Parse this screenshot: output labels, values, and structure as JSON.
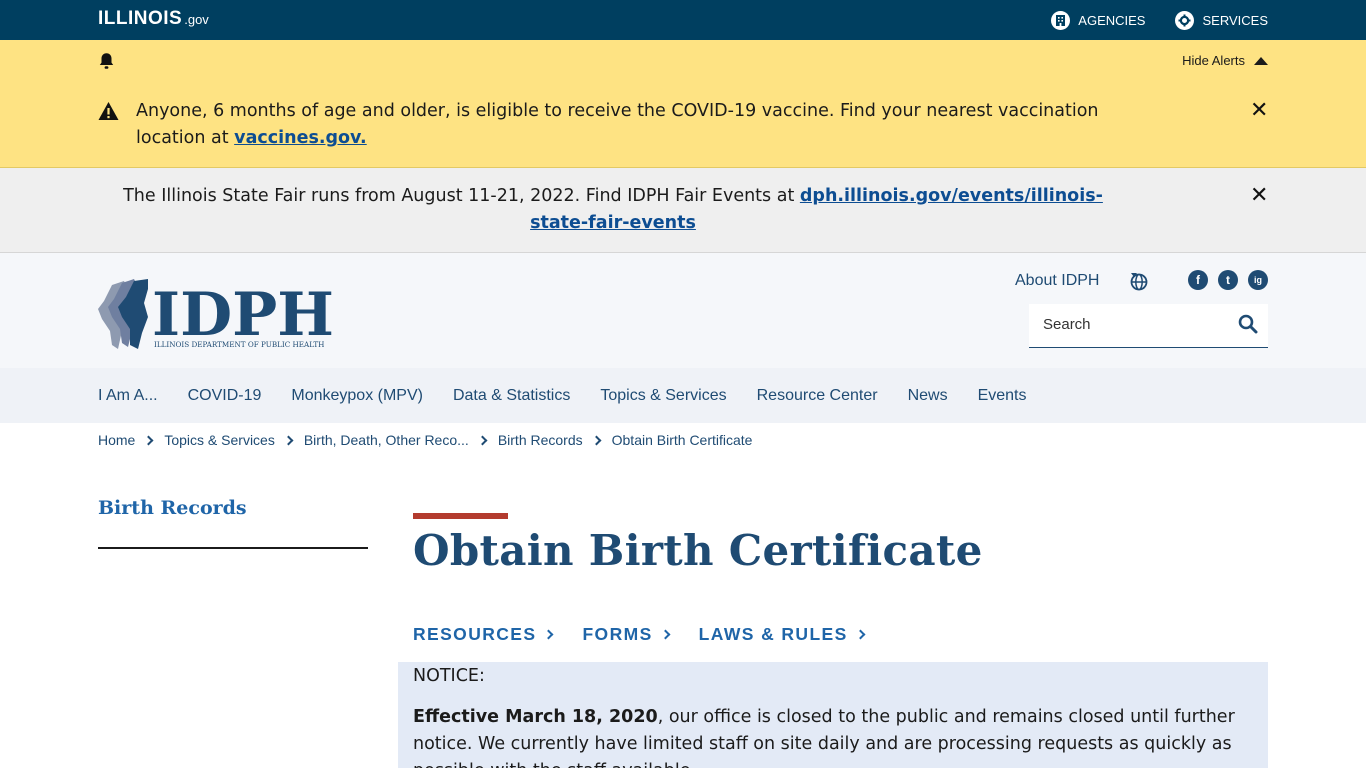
{
  "topbar": {
    "logo_main": "ILLINOIS",
    "logo_suffix": ".gov",
    "agencies_label": "AGENCIES",
    "services_label": "SERVICES"
  },
  "alerts": {
    "hide_label": "Hide Alerts",
    "covid_text": "Anyone, 6 months of age and older, is eligible to receive the COVID-19 vaccine. Find your nearest vaccination location at ",
    "covid_link": "vaccines.gov.",
    "fair_text": "The Illinois State Fair runs from August 11-21, 2022. Find IDPH Fair Events at ",
    "fair_link": "dph.illinois.gov/events/illinois-state-fair-events"
  },
  "header": {
    "logo_text": "IDPH",
    "logo_subtitle": "ILLINOIS DEPARTMENT OF PUBLIC HEALTH",
    "about_label": "About IDPH",
    "search_placeholder": "Search",
    "social": [
      "f",
      "t",
      "ig"
    ]
  },
  "nav": {
    "items": [
      "I Am A...",
      "COVID-19",
      "Monkeypox (MPV)",
      "Data & Statistics",
      "Topics & Services",
      "Resource Center",
      "News",
      "Events"
    ]
  },
  "breadcrumb": [
    "Home",
    "Topics & Services",
    "Birth, Death, Other Reco...",
    "Birth Records",
    "Obtain Birth Certificate"
  ],
  "sidebar": {
    "title": "Birth Records"
  },
  "main": {
    "title": "Obtain Birth Certificate",
    "tabs": [
      "RESOURCES",
      "FORMS",
      "LAWS & RULES"
    ],
    "notice_label": "NOTICE:",
    "notice_bold": "Effective March 18, 2020",
    "notice_text": ", our office is closed to the public and remains closed until further notice. We currently have limited staff on site daily and are processing requests as quickly as possible with the staff available."
  },
  "colors": {
    "topbar": "#003f60",
    "alert_yellow": "#fee383",
    "brand_blue": "#1f4b73",
    "link_blue": "#1f65a8",
    "accent_red": "#b33b2e"
  }
}
